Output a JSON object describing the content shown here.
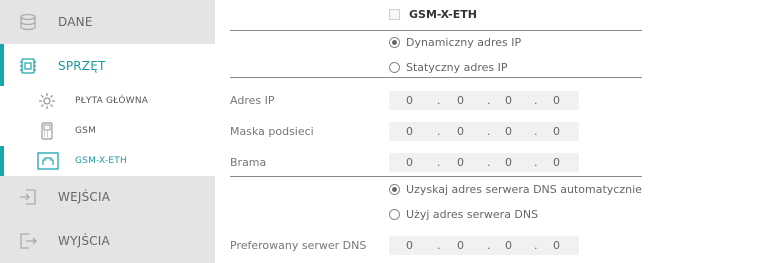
{
  "sidebar": {
    "items": [
      {
        "label": "DANE",
        "icon": "database-icon"
      },
      {
        "label": "SPRZĘT",
        "icon": "hardware-chip-icon"
      },
      {
        "label": "WEJŚCIA",
        "icon": "input-icon"
      },
      {
        "label": "WYJŚCIA",
        "icon": "output-icon"
      }
    ],
    "subitems": [
      {
        "label": "PŁYTA GŁÓWNA",
        "icon": "gear-icon"
      },
      {
        "label": "GSM",
        "icon": "phone-icon"
      },
      {
        "label": "GSM-X-ETH",
        "icon": "ethernet-icon"
      }
    ]
  },
  "main": {
    "title": "GSM-X-ETH",
    "ip_mode": {
      "dynamic_label": "Dynamiczny adres IP",
      "static_label": "Statyczny adres IP",
      "selected": "dynamic"
    },
    "fields": {
      "ip_label": "Adres IP",
      "mask_label": "Maska podsieci",
      "gateway_label": "Brama",
      "preferred_dns_label": "Preferowany serwer DNS"
    },
    "ip_values": {
      "ip": [
        "0",
        "0",
        "0",
        "0"
      ],
      "mask": [
        "0",
        "0",
        "0",
        "0"
      ],
      "gateway": [
        "0",
        "0",
        "0",
        "0"
      ],
      "dns": [
        "0",
        "0",
        "0",
        "0"
      ]
    },
    "dns_mode": {
      "auto_label": "Uzyskaj adres serwera DNS automatycznie",
      "manual_label": "Użyj adres serwera DNS",
      "selected": "auto"
    }
  },
  "colors": {
    "accent": "#1aa6ab",
    "sidebar_grey": "#e4e4e4"
  }
}
